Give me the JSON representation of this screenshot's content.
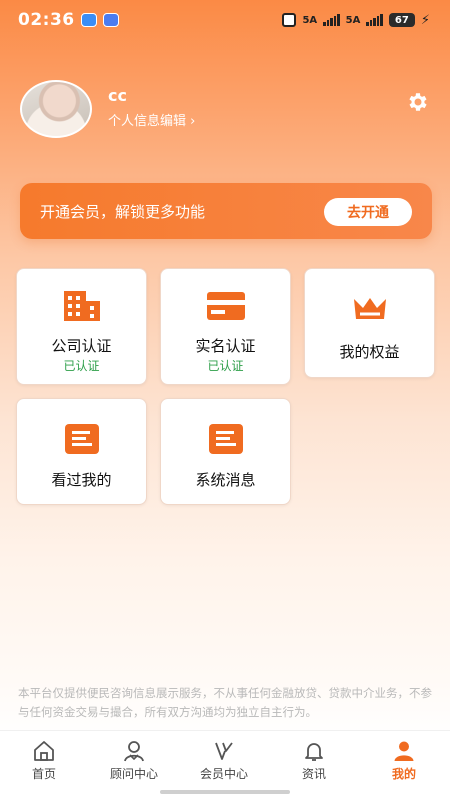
{
  "status_bar": {
    "time": "02:36",
    "signal1": "5A",
    "signal2": "5A",
    "battery": "67"
  },
  "profile": {
    "nickname": "cc",
    "edit_label": "个人信息编辑 ›"
  },
  "vip": {
    "text": "开通会员，解锁更多功能",
    "button": "去开通"
  },
  "tiles": [
    {
      "label": "公司认证",
      "status": "已认证",
      "icon": "building-icon"
    },
    {
      "label": "实名认证",
      "status": "已认证",
      "icon": "id-card-icon"
    },
    {
      "label": "我的权益",
      "icon": "crown-icon"
    },
    {
      "label": "看过我的",
      "icon": "document-icon"
    },
    {
      "label": "系统消息",
      "icon": "message-icon"
    }
  ],
  "disclaimer": "本平台仅提供便民咨询信息展示服务，不从事任何金融放贷、贷款中介业务，不参与任何资金交易与撮合，所有双方沟通均为独立自主行为。",
  "tabbar": [
    {
      "label": "首页",
      "icon": "home-icon"
    },
    {
      "label": "顾问中心",
      "icon": "advisor-icon"
    },
    {
      "label": "会员中心",
      "icon": "vip-icon"
    },
    {
      "label": "资讯",
      "icon": "bell-icon"
    },
    {
      "label": "我的",
      "icon": "user-icon",
      "active": true
    }
  ],
  "colors": {
    "accent": "#f06b20",
    "verified": "#2e9f4a",
    "tile_icon": "#f06b20"
  }
}
